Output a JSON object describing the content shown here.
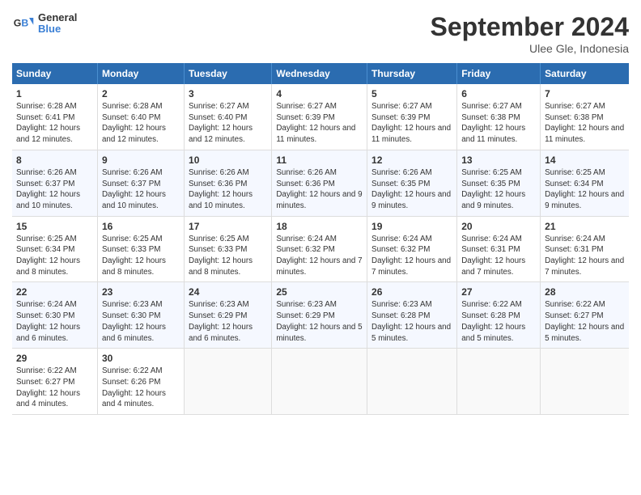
{
  "header": {
    "logo_line1": "General",
    "logo_line2": "Blue",
    "month_title": "September 2024",
    "location": "Ulee Gle, Indonesia"
  },
  "days_of_week": [
    "Sunday",
    "Monday",
    "Tuesday",
    "Wednesday",
    "Thursday",
    "Friday",
    "Saturday"
  ],
  "weeks": [
    [
      {
        "num": "1",
        "rise": "6:28 AM",
        "set": "6:41 PM",
        "daylight": "12 hours and 12 minutes."
      },
      {
        "num": "2",
        "rise": "6:28 AM",
        "set": "6:40 PM",
        "daylight": "12 hours and 12 minutes."
      },
      {
        "num": "3",
        "rise": "6:27 AM",
        "set": "6:40 PM",
        "daylight": "12 hours and 12 minutes."
      },
      {
        "num": "4",
        "rise": "6:27 AM",
        "set": "6:39 PM",
        "daylight": "12 hours and 11 minutes."
      },
      {
        "num": "5",
        "rise": "6:27 AM",
        "set": "6:39 PM",
        "daylight": "12 hours and 11 minutes."
      },
      {
        "num": "6",
        "rise": "6:27 AM",
        "set": "6:38 PM",
        "daylight": "12 hours and 11 minutes."
      },
      {
        "num": "7",
        "rise": "6:27 AM",
        "set": "6:38 PM",
        "daylight": "12 hours and 11 minutes."
      }
    ],
    [
      {
        "num": "8",
        "rise": "6:26 AM",
        "set": "6:37 PM",
        "daylight": "12 hours and 10 minutes."
      },
      {
        "num": "9",
        "rise": "6:26 AM",
        "set": "6:37 PM",
        "daylight": "12 hours and 10 minutes."
      },
      {
        "num": "10",
        "rise": "6:26 AM",
        "set": "6:36 PM",
        "daylight": "12 hours and 10 minutes."
      },
      {
        "num": "11",
        "rise": "6:26 AM",
        "set": "6:36 PM",
        "daylight": "12 hours and 9 minutes."
      },
      {
        "num": "12",
        "rise": "6:26 AM",
        "set": "6:35 PM",
        "daylight": "12 hours and 9 minutes."
      },
      {
        "num": "13",
        "rise": "6:25 AM",
        "set": "6:35 PM",
        "daylight": "12 hours and 9 minutes."
      },
      {
        "num": "14",
        "rise": "6:25 AM",
        "set": "6:34 PM",
        "daylight": "12 hours and 9 minutes."
      }
    ],
    [
      {
        "num": "15",
        "rise": "6:25 AM",
        "set": "6:34 PM",
        "daylight": "12 hours and 8 minutes."
      },
      {
        "num": "16",
        "rise": "6:25 AM",
        "set": "6:33 PM",
        "daylight": "12 hours and 8 minutes."
      },
      {
        "num": "17",
        "rise": "6:25 AM",
        "set": "6:33 PM",
        "daylight": "12 hours and 8 minutes."
      },
      {
        "num": "18",
        "rise": "6:24 AM",
        "set": "6:32 PM",
        "daylight": "12 hours and 7 minutes."
      },
      {
        "num": "19",
        "rise": "6:24 AM",
        "set": "6:32 PM",
        "daylight": "12 hours and 7 minutes."
      },
      {
        "num": "20",
        "rise": "6:24 AM",
        "set": "6:31 PM",
        "daylight": "12 hours and 7 minutes."
      },
      {
        "num": "21",
        "rise": "6:24 AM",
        "set": "6:31 PM",
        "daylight": "12 hours and 7 minutes."
      }
    ],
    [
      {
        "num": "22",
        "rise": "6:24 AM",
        "set": "6:30 PM",
        "daylight": "12 hours and 6 minutes."
      },
      {
        "num": "23",
        "rise": "6:23 AM",
        "set": "6:30 PM",
        "daylight": "12 hours and 6 minutes."
      },
      {
        "num": "24",
        "rise": "6:23 AM",
        "set": "6:29 PM",
        "daylight": "12 hours and 6 minutes."
      },
      {
        "num": "25",
        "rise": "6:23 AM",
        "set": "6:29 PM",
        "daylight": "12 hours and 5 minutes."
      },
      {
        "num": "26",
        "rise": "6:23 AM",
        "set": "6:28 PM",
        "daylight": "12 hours and 5 minutes."
      },
      {
        "num": "27",
        "rise": "6:22 AM",
        "set": "6:28 PM",
        "daylight": "12 hours and 5 minutes."
      },
      {
        "num": "28",
        "rise": "6:22 AM",
        "set": "6:27 PM",
        "daylight": "12 hours and 5 minutes."
      }
    ],
    [
      {
        "num": "29",
        "rise": "6:22 AM",
        "set": "6:27 PM",
        "daylight": "12 hours and 4 minutes."
      },
      {
        "num": "30",
        "rise": "6:22 AM",
        "set": "6:26 PM",
        "daylight": "12 hours and 4 minutes."
      },
      null,
      null,
      null,
      null,
      null
    ]
  ]
}
